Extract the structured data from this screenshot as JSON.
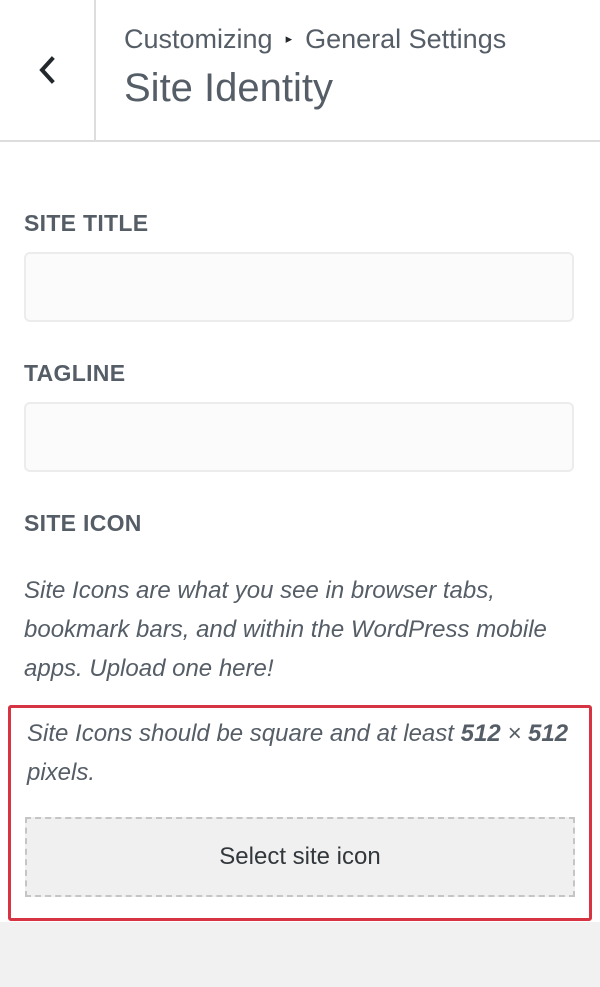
{
  "header": {
    "back_icon": "chevron-left-icon",
    "breadcrumb": {
      "root": "Customizing",
      "separator": "▸",
      "parent": "General Settings"
    },
    "title": "Site Identity"
  },
  "site_title": {
    "label": "SITE TITLE",
    "value": ""
  },
  "tagline": {
    "label": "TAGLINE",
    "value": ""
  },
  "site_icon": {
    "label": "SITE ICON",
    "description": "Site Icons are what you see in browser tabs, bookmark bars, and within the WordPress mobile apps. Upload one here!",
    "notice_prefix": "Site Icons should be square and at least ",
    "notice_size_1": "512",
    "notice_times": " × ",
    "notice_size_2": "512",
    "notice_suffix": " pixels.",
    "select_button_label": "Select site icon"
  },
  "colors": {
    "highlight_border": "#d63343",
    "text": "#555d66",
    "panel_background": "#ffffff",
    "page_background": "#f1f1f1"
  }
}
